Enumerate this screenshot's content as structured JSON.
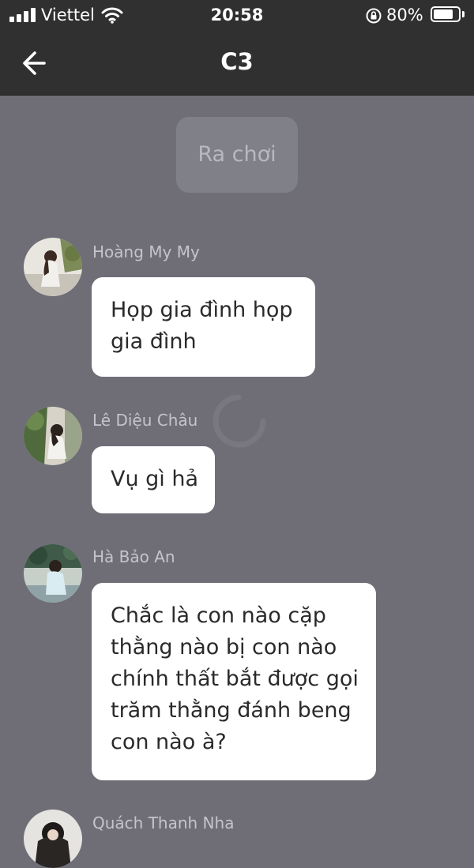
{
  "status_bar": {
    "carrier": "Viettel",
    "time": "20:58",
    "battery_percent": "80%",
    "battery_level": 0.8,
    "icons": [
      "signal-bars-icon",
      "wifi-icon",
      "rotation-lock-icon",
      "battery-icon"
    ]
  },
  "nav": {
    "title": "C3",
    "back_icon": "arrow-left-icon"
  },
  "chat": {
    "system_message": "Ra chơi",
    "messages": [
      {
        "sender": "Hoàng My My",
        "lines": [
          "Họp gia đình họp",
          "gia đình"
        ]
      },
      {
        "sender": "Lê Diệu Châu",
        "lines": [
          "Vụ gì hả"
        ]
      },
      {
        "sender": "Hà Bảo An",
        "lines": [
          "Chắc là con nào cặp",
          "thằng nào bị con nào",
          "chính thất bắt được gọi",
          "trăm thằng đánh beng",
          "con nào à?"
        ]
      },
      {
        "sender": "Quách Thanh Nha",
        "lines": []
      }
    ]
  },
  "colors": {
    "chat_background": "#6f6e77",
    "header_background": "#303030",
    "bubble_background": "#ffffff",
    "sender_name": "#c5c4cc"
  }
}
